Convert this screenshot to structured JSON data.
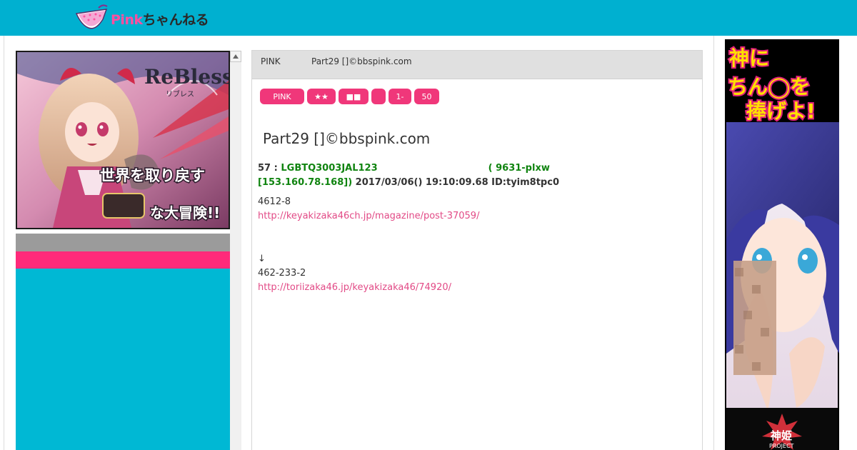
{
  "header": {
    "logo_pink": "Pink",
    "logo_jp": "ちゃんねる"
  },
  "left_ad": {
    "brand": "ReBless",
    "brand_sub": "リブレス",
    "tagline_1": "世界を取り戻す",
    "tagline_2": "な大冒険!!"
  },
  "board": {
    "name": "PINK",
    "thread_small": "Part29 []©bbspink.com"
  },
  "nav_buttons": [
    "PINK",
    "★★",
    "■■",
    "",
    "1-",
    "50"
  ],
  "thread": {
    "title": "Part29 []©bbspink.com"
  },
  "post": {
    "number": "57",
    "sep": " : ",
    "name": "LGBTQ3003JAL123",
    "id_part": "( 9631-plxw",
    "ip": "[153.160.78.168])",
    "datetime": " 2017/03/06() 19:10:09.68 ID:tyim8tpc0",
    "lines": [
      {
        "text": "4612-8",
        "link": false
      },
      {
        "text": "http://keyakizaka46ch.jp/magazine/post-37059/",
        "link": true
      },
      {
        "text": "",
        "link": false
      },
      {
        "text": "",
        "link": false
      },
      {
        "text": "↓",
        "link": false
      },
      {
        "text": "462-233-2",
        "link": false
      },
      {
        "text": "http://toriizaka46.jp/keyakizaka46/74920/",
        "link": true
      }
    ]
  },
  "right_ad": {
    "line1": "神に",
    "line2": "ちん◯を",
    "line3": "捧げよ!",
    "brand": "神姫",
    "brand_sub": "PROJECT"
  },
  "colors": {
    "topbar": "#00b0d0",
    "accent_pink": "#f0377a",
    "name_green": "#108410",
    "link": "#e24a86"
  }
}
